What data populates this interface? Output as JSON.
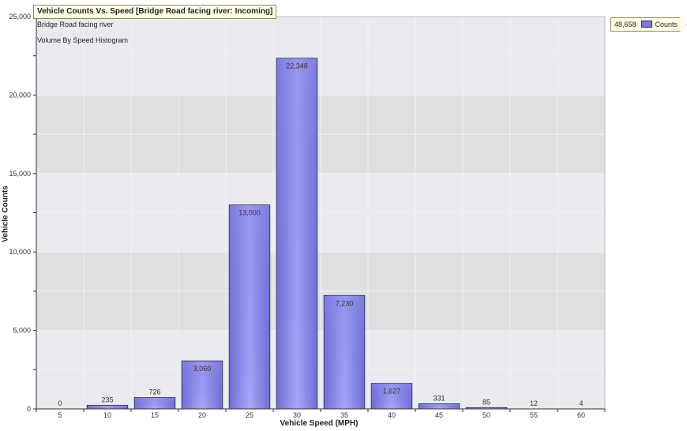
{
  "title": "Vehicle Counts Vs. Speed [Bridge Road facing river: Incoming]",
  "subtitles": [
    "Bridge Road facing river",
    "Volume By Speed Histogram"
  ],
  "legend": {
    "total": "48,658",
    "label": "Counts"
  },
  "colors": {
    "bar": "#7b78e0",
    "bar_light": "#a7a6f7",
    "plot_bg": "#e6e8eb",
    "plot_bg_alt": "#dedfe1",
    "grid": "#f2f2f2"
  },
  "chart_data": {
    "type": "bar",
    "title": "Vehicle Counts Vs. Speed [Bridge Road facing river: Incoming]",
    "xlabel": "Vehicle Speed (MPH)",
    "ylabel": "Vehicle Counts",
    "categories": [
      "5",
      "10",
      "15",
      "20",
      "25",
      "30",
      "35",
      "40",
      "45",
      "50",
      "55",
      "60"
    ],
    "series": [
      {
        "name": "Counts",
        "values": [
          0,
          235,
          726,
          3060,
          13000,
          22348,
          7230,
          1627,
          331,
          85,
          12,
          4
        ]
      }
    ],
    "value_labels": [
      "0",
      "235",
      "726",
      "3,060",
      "13,000",
      "22,348",
      "7,230",
      "1,627",
      "331",
      "85",
      "12",
      "4"
    ],
    "ylim": [
      0,
      25000
    ],
    "yticks": [
      0,
      5000,
      10000,
      15000,
      20000,
      25000
    ],
    "ytick_labels": [
      "0",
      "5,000",
      "10,000",
      "15,000",
      "20,000",
      "25,000"
    ],
    "grid": true,
    "legend_position": "top-right"
  }
}
